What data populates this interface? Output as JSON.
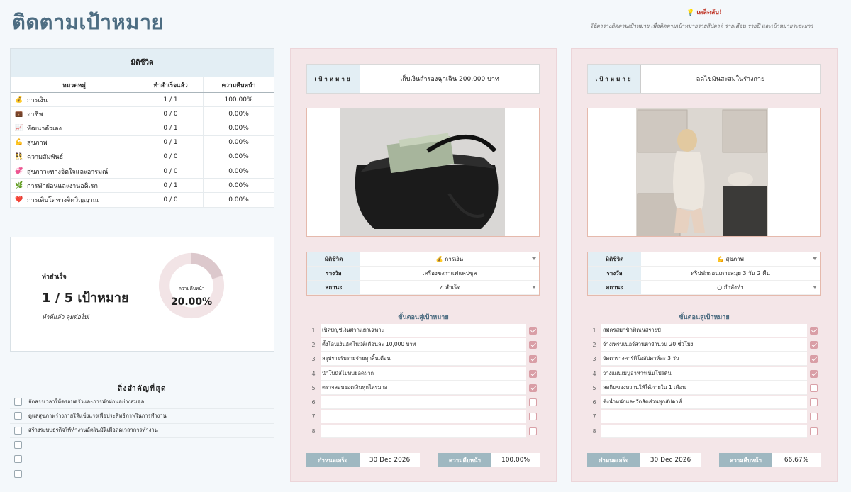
{
  "title": "ติดตามเป้าหมาย",
  "tip": {
    "heading": "💡 เคล็ดลับ!",
    "text": "ใช้ตารางติดตามเป้าหมาย เพื่อติดตามเป้าหมายรายสัปดาห์ รายเดือน รายปี และเป้าหมายระยะยาว"
  },
  "category_table": {
    "title": "มิติชีวิต",
    "headers": [
      "หมวดหมู่",
      "ทำสำเร็จแล้ว",
      "ความคืบหน้า"
    ],
    "rows": [
      {
        "icon": "💰",
        "name": "การเงิน",
        "done": "1 / 1",
        "progress": "100.00%"
      },
      {
        "icon": "💼",
        "name": "อาชีพ",
        "done": "0 / 0",
        "progress": "0.00%"
      },
      {
        "icon": "📈",
        "name": "พัฒนาตัวเอง",
        "done": "0 / 1",
        "progress": "0.00%"
      },
      {
        "icon": "💪",
        "name": "สุขภาพ",
        "done": "0 / 1",
        "progress": "0.00%"
      },
      {
        "icon": "👯",
        "name": "ความสัมพันธ์",
        "done": "0 / 0",
        "progress": "0.00%"
      },
      {
        "icon": "💞",
        "name": "สุขภาวะทางจิตใจและอารมณ์",
        "done": "0 / 0",
        "progress": "0.00%"
      },
      {
        "icon": "🌿",
        "name": "การพักผ่อนและงานอดิเรก",
        "done": "0 / 1",
        "progress": "0.00%"
      },
      {
        "icon": "❤️",
        "name": "การเติบโตทางจิตวิญญาณ",
        "done": "0 / 0",
        "progress": "0.00%"
      }
    ]
  },
  "achievement": {
    "label": "ทำสำเร็จ",
    "count": "1 / 5 เป้าหมาย",
    "sub": "ทำดีแล้ว ลุยต่อไป!",
    "donut_label": "ความคืบหน้า",
    "donut_value": "20.00%",
    "progress_fraction": 0.2,
    "colors": {
      "track": "#f2e4e6",
      "fill": "#dcc8cc"
    }
  },
  "priorities": {
    "title": "สิ่งสำคัญที่สุด",
    "items": [
      "จัดสรรเวลาให้ครอบครัวและการพักผ่อนอย่างสมดุล",
      "ดูแลสุขภาพร่างกายให้แข็งแรงเพื่อประสิทธิภาพในการทำงาน",
      "สร้างระบบธุรกิจให้ทำงานอัตโนมัติเพื่อลดเวลาการทำงาน",
      "",
      "",
      ""
    ]
  },
  "goals": [
    {
      "goal_label": "เป้าหมาย",
      "goal": "เก็บเงินสำรองฉุกเฉิน 200,000 บาท",
      "image": "bag-of-money",
      "props": [
        {
          "label": "มิติชีวิต",
          "value": "💰 การเงิน",
          "dropdown": true
        },
        {
          "label": "รางวัล",
          "value": "เครื่องชงกาแฟแคปซูล",
          "dropdown": false
        },
        {
          "label": "สถานะ",
          "value": "✓ สำเร็จ",
          "dropdown": true
        }
      ],
      "steps_title": "ขั้นตอนสู่เป้าหมาย",
      "steps": [
        {
          "n": "1",
          "text": "เปิดบัญชีเงินฝากแยกเฉพาะ",
          "done": true
        },
        {
          "n": "2",
          "text": "ตั้งโอนเงินอัตโนมัติเดือนละ 10,000 บาท",
          "done": true
        },
        {
          "n": "3",
          "text": "สรุปรายรับรายจ่ายทุกสิ้นเดือน",
          "done": true
        },
        {
          "n": "4",
          "text": "นำโบนัสไปทบยอดฝาก",
          "done": true
        },
        {
          "n": "5",
          "text": "ตรวจสอบยอดเงินทุกไตรมาส",
          "done": true
        },
        {
          "n": "6",
          "text": "",
          "done": false
        },
        {
          "n": "7",
          "text": "",
          "done": false
        },
        {
          "n": "8",
          "text": "",
          "done": false
        }
      ],
      "deadline_label": "กำหนดเสร็จ",
      "deadline": "30 Dec 2026",
      "progress_label": "ความคืบหน้า",
      "progress": "100.00%"
    },
    {
      "goal_label": "เป้าหมาย",
      "goal": "ลดไขมันสะสมในร่างกาย",
      "image": "woman-in-kitchen",
      "props": [
        {
          "label": "มิติชีวิต",
          "value": "💪 สุขภาพ",
          "dropdown": true
        },
        {
          "label": "รางวัล",
          "value": "ทริปพักผ่อนเกาะสมุย 3 วัน 2 คืน",
          "dropdown": false
        },
        {
          "label": "สถานะ",
          "value": "○ กำลังทำ",
          "dropdown": true
        }
      ],
      "steps_title": "ขั้นตอนสู่เป้าหมาย",
      "steps": [
        {
          "n": "1",
          "text": "สมัครสมาชิกฟิตเนสรายปี",
          "done": true
        },
        {
          "n": "2",
          "text": "จ้างเทรนเนอร์ส่วนตัวจำนวน 20 ชั่วโมง",
          "done": true
        },
        {
          "n": "3",
          "text": "จัดตารางคาร์ดิโอสัปดาห์ละ 3 วัน",
          "done": true
        },
        {
          "n": "4",
          "text": "วางแผนเมนูอาหารเน้นโปรตีน",
          "done": true
        },
        {
          "n": "5",
          "text": "ลดกินของหวานให้ได้ภายใน 1 เดือน",
          "done": false
        },
        {
          "n": "6",
          "text": "ชั่งน้ำหนักและวัดสัดส่วนทุกสัปดาห์",
          "done": false
        },
        {
          "n": "7",
          "text": "",
          "done": false
        },
        {
          "n": "8",
          "text": "",
          "done": false
        }
      ],
      "deadline_label": "กำหนดเสร็จ",
      "deadline": "30 Dec 2026",
      "progress_label": "ความคืบหน้า",
      "progress": "66.67%"
    }
  ]
}
